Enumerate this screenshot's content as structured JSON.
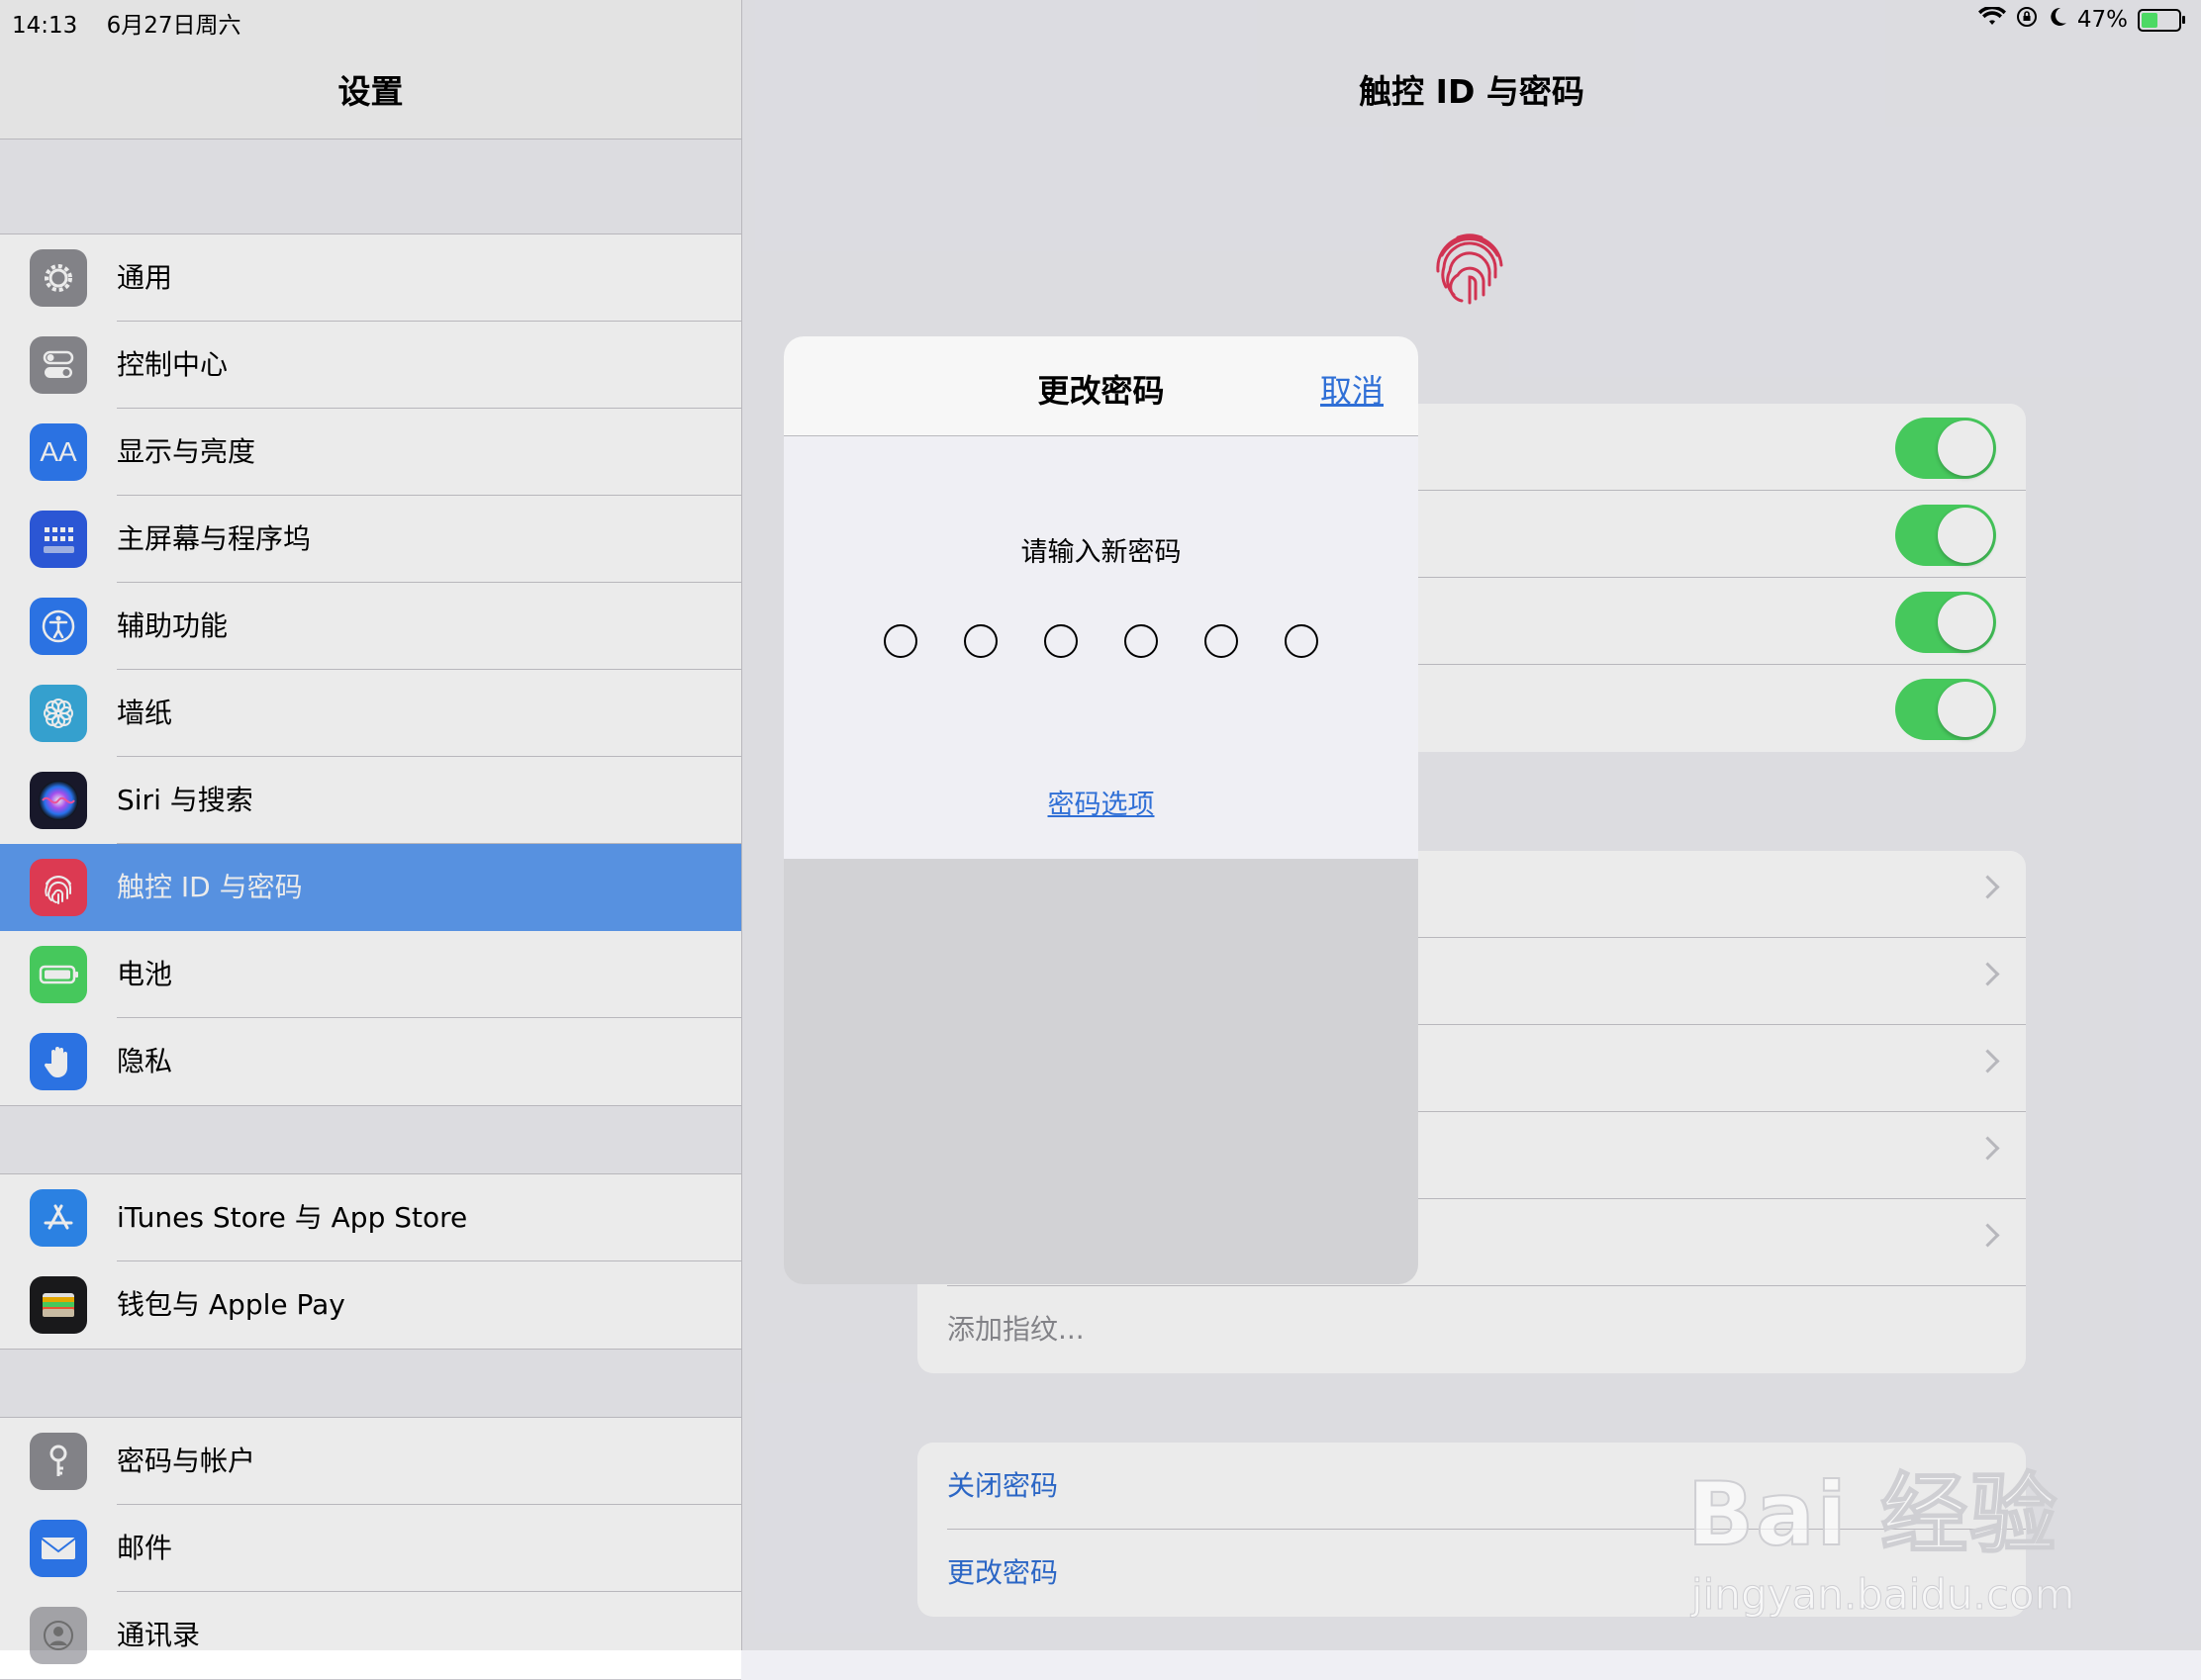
{
  "status_bar": {
    "time": "14:13",
    "date": "6月27日周六",
    "battery_percent": "47%",
    "battery_level": 0.47
  },
  "sidebar": {
    "title": "设置",
    "group1": [
      {
        "label": "通用",
        "icon": "gear-icon",
        "color": "#8e8e93"
      },
      {
        "label": "控制中心",
        "icon": "toggles-icon",
        "color": "#8e8e93"
      },
      {
        "label": "显示与亮度",
        "icon": "text-size-icon",
        "color": "#2f7cf6"
      },
      {
        "label": "主屏幕与程序坞",
        "icon": "grid-icon",
        "color": "#2f5ee6"
      },
      {
        "label": "辅助功能",
        "icon": "accessibility-icon",
        "color": "#2f7cf6"
      },
      {
        "label": "墙纸",
        "icon": "flower-icon",
        "color": "#3aaee0"
      },
      {
        "label": "Siri 与搜索",
        "icon": "siri-icon",
        "color": "#1b1b2e"
      },
      {
        "label": "触控 ID 与密码",
        "icon": "fingerprint-icon",
        "color": "#ef3f5a",
        "selected": true
      },
      {
        "label": "电池",
        "icon": "battery-icon",
        "color": "#4cd964"
      },
      {
        "label": "隐私",
        "icon": "hand-icon",
        "color": "#2f7cf6"
      }
    ],
    "group2": [
      {
        "label": "iTunes Store 与 App Store",
        "icon": "app-store-icon",
        "color": "#2f8cf6"
      },
      {
        "label": "钱包与 Apple Pay",
        "icon": "wallet-icon",
        "color": "#1c1c1e"
      }
    ],
    "group3": [
      {
        "label": "密码与帐户",
        "icon": "key-icon",
        "color": "#8e8e93"
      },
      {
        "label": "邮件",
        "icon": "mail-icon",
        "color": "#2f7cf6"
      },
      {
        "label": "通讯录",
        "icon": "contacts-icon",
        "color": "#b0b0b5"
      }
    ]
  },
  "detail": {
    "title": "触控 ID 与密码",
    "add_fingerprint": "添加指纹...",
    "turn_off_passcode": "关闭密码",
    "change_passcode": "更改密码"
  },
  "modal": {
    "title": "更改密码",
    "cancel": "取消",
    "prompt": "请输入新密码",
    "options": "密码选项"
  },
  "watermark": {
    "line1": "Bai 经验",
    "line2": "jingyan.baidu.com"
  }
}
